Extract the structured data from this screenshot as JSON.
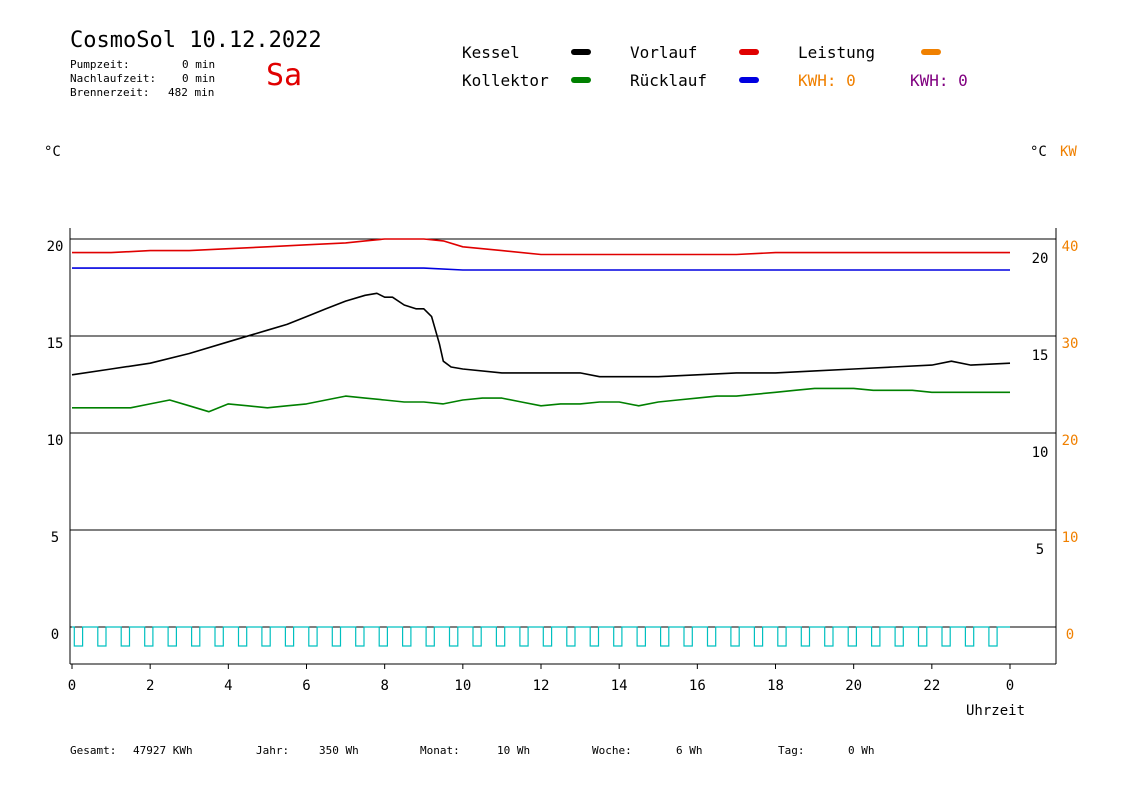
{
  "header": {
    "title": "CosmoSol 10.12.2022",
    "day": "Sa",
    "stats": [
      {
        "label": "Pumpzeit:",
        "value": "0 min"
      },
      {
        "label": "Nachlaufzeit:",
        "value": "0 min"
      },
      {
        "label": "Brennerzeit:",
        "value": "482 min"
      }
    ]
  },
  "legend": {
    "kessel": {
      "label": "Kessel",
      "color": "#000000"
    },
    "vorlauf": {
      "label": "Vorlauf",
      "color": "#e00000"
    },
    "leistung": {
      "label": "Leistung",
      "color": "#f08000"
    },
    "kollektor": {
      "label": "Kollektor",
      "color": "#008000"
    },
    "ruecklauf": {
      "label": "Rücklauf",
      "color": "#0000e0"
    },
    "kwh1": {
      "label": "KWH: 0",
      "color": "#f08000"
    },
    "kwh2": {
      "label": "KWH: 0",
      "color": "#800080"
    }
  },
  "units": {
    "left": "°C",
    "right_c": "°C",
    "right_kw": "KW"
  },
  "footer": [
    {
      "label": "Gesamt:",
      "value": "47927 KWh"
    },
    {
      "label": "Jahr:",
      "value": "350 Wh"
    },
    {
      "label": "Monat:",
      "value": "10 Wh"
    },
    {
      "label": "Woche:",
      "value": "6 Wh"
    },
    {
      "label": "Tag:",
      "value": "0 Wh"
    }
  ],
  "chart_data": {
    "type": "line",
    "title": "CosmoSol 10.12.2022",
    "xlabel": "Uhrzeit",
    "x_ticks": [
      "0",
      "2",
      "4",
      "6",
      "8",
      "10",
      "12",
      "14",
      "16",
      "18",
      "20",
      "22",
      "0"
    ],
    "xlim": [
      0,
      24
    ],
    "ylim": [
      0,
      20
    ],
    "y_ticks_left": [
      "0",
      "5",
      "10",
      "15",
      "20"
    ],
    "y_ticks_right_c": [
      "5",
      "10",
      "15",
      "20"
    ],
    "y_ticks_right_kw": [
      "0",
      "10",
      "20",
      "30",
      "40"
    ],
    "grid": "horizontal",
    "series": [
      {
        "name": "Vorlauf",
        "color": "#e00000",
        "x": [
          0,
          1,
          2,
          3,
          4,
          5,
          6,
          7,
          7.5,
          8,
          9,
          9.5,
          10,
          11,
          12,
          13,
          14,
          15,
          16,
          17,
          18,
          19,
          20,
          21,
          22,
          23,
          24
        ],
        "y": [
          19.3,
          19.3,
          19.4,
          19.4,
          19.5,
          19.6,
          19.7,
          19.8,
          19.9,
          20.0,
          20.0,
          19.9,
          19.6,
          19.4,
          19.2,
          19.2,
          19.2,
          19.2,
          19.2,
          19.2,
          19.3,
          19.3,
          19.3,
          19.3,
          19.3,
          19.3,
          19.3
        ]
      },
      {
        "name": "Rücklauf",
        "color": "#0000e0",
        "x": [
          0,
          1,
          2,
          3,
          4,
          5,
          6,
          7,
          8,
          9,
          10,
          11,
          12,
          13,
          14,
          15,
          16,
          17,
          18,
          19,
          20,
          21,
          22,
          23,
          24
        ],
        "y": [
          18.5,
          18.5,
          18.5,
          18.5,
          18.5,
          18.5,
          18.5,
          18.5,
          18.5,
          18.5,
          18.4,
          18.4,
          18.4,
          18.4,
          18.4,
          18.4,
          18.4,
          18.4,
          18.4,
          18.4,
          18.4,
          18.4,
          18.4,
          18.4,
          18.4
        ]
      },
      {
        "name": "Kessel",
        "color": "#000000",
        "x": [
          0,
          1,
          2,
          3,
          4,
          5,
          5.5,
          6,
          6.5,
          7,
          7.5,
          7.8,
          8,
          8.2,
          8.5,
          8.8,
          9,
          9.2,
          9.4,
          9.5,
          9.7,
          10,
          11,
          12,
          13,
          13.5,
          14,
          15,
          16,
          17,
          18,
          19,
          20,
          21,
          22,
          22.5,
          23,
          24
        ],
        "y": [
          13.0,
          13.3,
          13.6,
          14.1,
          14.7,
          15.3,
          15.6,
          16.0,
          16.4,
          16.8,
          17.1,
          17.2,
          17.0,
          17.0,
          16.6,
          16.4,
          16.4,
          16.0,
          14.6,
          13.7,
          13.4,
          13.3,
          13.1,
          13.1,
          13.1,
          12.9,
          12.9,
          12.9,
          13.0,
          13.1,
          13.1,
          13.2,
          13.3,
          13.4,
          13.5,
          13.7,
          13.5,
          13.6
        ]
      },
      {
        "name": "Kollektor",
        "color": "#008000",
        "x": [
          0,
          1,
          1.5,
          2,
          2.5,
          3,
          3.5,
          4,
          4.5,
          5,
          5.5,
          6,
          6.5,
          7,
          7.5,
          8,
          8.5,
          9,
          9.5,
          10,
          10.5,
          11,
          11.5,
          12,
          12.5,
          13,
          13.5,
          14,
          14.5,
          15,
          15.5,
          16,
          16.5,
          17,
          17.5,
          18,
          18.5,
          19,
          19.5,
          20,
          20.5,
          21,
          21.5,
          22,
          22.5,
          23,
          23.5,
          24
        ],
        "y": [
          11.3,
          11.3,
          11.3,
          11.5,
          11.7,
          11.4,
          11.1,
          11.5,
          11.4,
          11.3,
          11.4,
          11.5,
          11.7,
          11.9,
          11.8,
          11.7,
          11.6,
          11.6,
          11.5,
          11.7,
          11.8,
          11.8,
          11.6,
          11.4,
          11.5,
          11.5,
          11.6,
          11.6,
          11.4,
          11.6,
          11.7,
          11.8,
          11.9,
          11.9,
          12.0,
          12.1,
          12.2,
          12.3,
          12.3,
          12.3,
          12.2,
          12.2,
          12.2,
          12.1,
          12.1,
          12.1,
          12.1,
          12.1
        ]
      }
    ],
    "pump_pulses": {
      "color": "#00c0c0",
      "count": 40
    }
  }
}
